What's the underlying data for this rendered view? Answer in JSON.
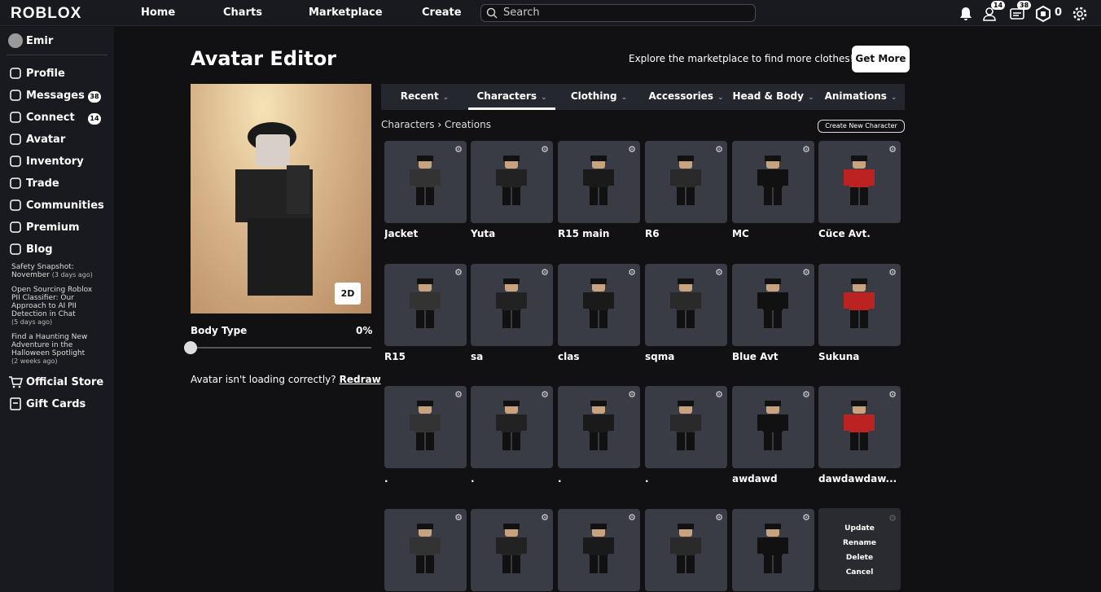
{
  "topbar": {
    "logo": "ROBLOX",
    "nav": [
      "Home",
      "Charts",
      "Marketplace",
      "Create"
    ],
    "search_placeholder": "Search",
    "friends_badge": "14",
    "messages_badge": "38",
    "robux": "0"
  },
  "sidebar": {
    "user": "Emir",
    "items": [
      {
        "label": "Profile",
        "icon": "person-icon"
      },
      {
        "label": "Messages",
        "icon": "message-icon",
        "badge": "38"
      },
      {
        "label": "Connect",
        "icon": "friends-icon",
        "badge": "14"
      },
      {
        "label": "Avatar",
        "icon": "avatar-icon"
      },
      {
        "label": "Inventory",
        "icon": "inventory-icon"
      },
      {
        "label": "Trade",
        "icon": "trade-icon"
      },
      {
        "label": "Communities",
        "icon": "communities-icon"
      },
      {
        "label": "Premium",
        "icon": "premium-icon"
      },
      {
        "label": "Blog",
        "icon": "blog-icon"
      }
    ],
    "blog": [
      {
        "title": "Safety Snapshot: November",
        "age": "(3 days ago)"
      },
      {
        "title": "Open Sourcing Roblox PII Classifier: Our Approach to AI PII Detection in Chat",
        "age": "(5 days ago)"
      },
      {
        "title": "Find a Haunting New Adventure in the Halloween Spotlight",
        "age": "(2 weeks ago)"
      }
    ],
    "bottom": [
      {
        "label": "Official Store",
        "icon": "cart-icon"
      },
      {
        "label": "Gift Cards",
        "icon": "gift-card-icon"
      }
    ]
  },
  "main": {
    "title": "Avatar Editor",
    "explore": "Explore the marketplace to find more clothes!",
    "get_more": "Get More",
    "btn_2d": "2D",
    "body_type_label": "Body Type",
    "body_type_value": "0%",
    "body_type_percent": 0,
    "loading_msg": "Avatar isn't loading correctly?",
    "redraw": "Redraw",
    "tabs": [
      "Recent",
      "Characters",
      "Clothing",
      "Accessories",
      "Head & Body",
      "Animations"
    ],
    "active_tab": 1,
    "breadcrumb": [
      "Characters",
      "Creations"
    ],
    "create_new": "Create New Character",
    "characters": [
      "Jacket",
      "Yuta",
      "R15 main",
      "R6",
      "MC",
      "Cüce Avt.",
      "R15",
      "sa",
      "clas",
      "sqma",
      "Blue Avt",
      "Sukuna",
      ".",
      ".",
      ".",
      ".",
      "awdawd",
      "dawdawdaw...",
      "",
      "",
      "",
      "",
      ""
    ],
    "context_menu": [
      "Update",
      "Rename",
      "Delete",
      "Cancel"
    ]
  }
}
